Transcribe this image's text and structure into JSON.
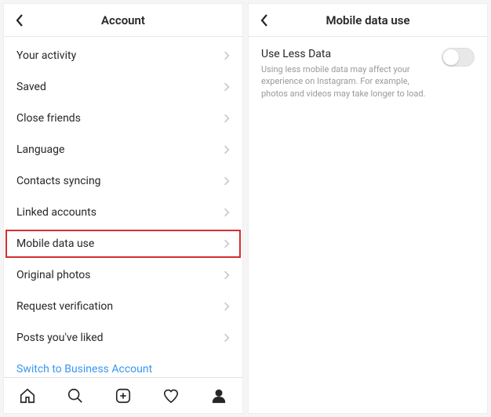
{
  "left": {
    "title": "Account",
    "items": [
      {
        "label": "Your activity",
        "name": "row-your-activity",
        "highlight": false
      },
      {
        "label": "Saved",
        "name": "row-saved",
        "highlight": false
      },
      {
        "label": "Close friends",
        "name": "row-close-friends",
        "highlight": false
      },
      {
        "label": "Language",
        "name": "row-language",
        "highlight": false
      },
      {
        "label": "Contacts syncing",
        "name": "row-contacts-syncing",
        "highlight": false
      },
      {
        "label": "Linked accounts",
        "name": "row-linked-accounts",
        "highlight": false
      },
      {
        "label": "Mobile data use",
        "name": "row-mobile-data-use",
        "highlight": true
      },
      {
        "label": "Original photos",
        "name": "row-original-photos",
        "highlight": false
      },
      {
        "label": "Request verification",
        "name": "row-request-verification",
        "highlight": false
      },
      {
        "label": "Posts you've liked",
        "name": "row-posts-liked",
        "highlight": false
      }
    ],
    "link": "Switch to Business Account"
  },
  "right": {
    "title": "Mobile data use",
    "setting": {
      "title": "Use Less Data",
      "description": "Using less mobile data may affect your experience on Instagram. For example, photos and videos may take longer to load."
    }
  },
  "tabs": [
    {
      "name": "home-icon"
    },
    {
      "name": "search-icon"
    },
    {
      "name": "add-post-icon"
    },
    {
      "name": "activity-icon"
    },
    {
      "name": "profile-icon"
    }
  ]
}
